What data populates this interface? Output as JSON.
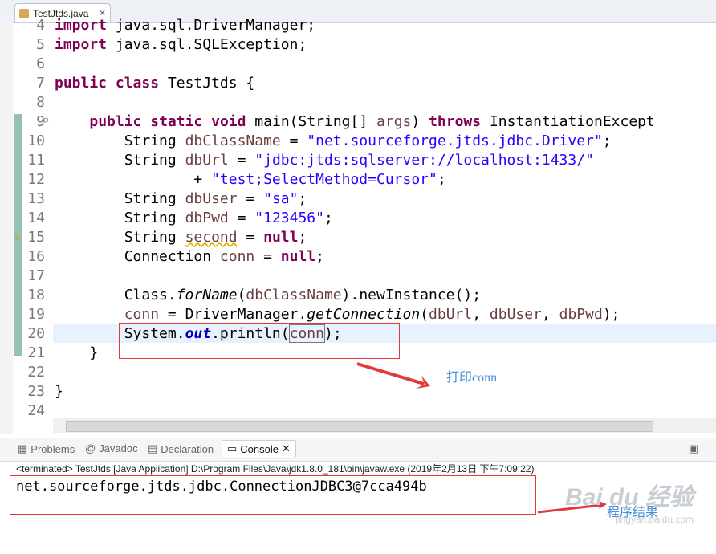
{
  "editor": {
    "tab_label": "TestJtds.java",
    "close_glyph": "✕",
    "lines": [
      {
        "n": "4",
        "html": "<span class='kw'>import</span> java.sql.DriverManager;"
      },
      {
        "n": "5",
        "html": "<span class='kw'>import</span> java.sql.SQLException;"
      },
      {
        "n": "6",
        "html": ""
      },
      {
        "n": "7",
        "html": "<span class='kw'>public</span> <span class='kw'>class</span> TestJtds {"
      },
      {
        "n": "8",
        "html": ""
      },
      {
        "n": "9",
        "html": "    <span class='kw'>public</span> <span class='kw'>static</span> <span class='kw'>void</span> main(String[] <span class='var'>args</span>) <span class='kw'>throws</span> InstantiationExcept"
      },
      {
        "n": "10",
        "html": "        String <span class='var'>dbClassName</span> = <span class='str'>\"net.sourceforge.jtds.jdbc.Driver\"</span>;"
      },
      {
        "n": "11",
        "html": "        String <span class='var'>dbUrl</span> = <span class='str'>\"jdbc:jtds:sqlserver://localhost:1433/\"</span>"
      },
      {
        "n": "12",
        "html": "                + <span class='str'>\"test;SelectMethod=Cursor\"</span>;"
      },
      {
        "n": "13",
        "html": "        String <span class='var'>dbUser</span> = <span class='str'>\"sa\"</span>;"
      },
      {
        "n": "14",
        "html": "        String <span class='var'>dbPwd</span> = <span class='str'>\"123456\"</span>;"
      },
      {
        "n": "15",
        "html": "        String <span class='var' style='text-decoration:underline wavy #e0b000'>second</span> = <span class='kw'>null</span>;"
      },
      {
        "n": "16",
        "html": "        Connection <span class='var'>conn</span> = <span class='kw'>null</span>;"
      },
      {
        "n": "17",
        "html": ""
      },
      {
        "n": "18",
        "html": "        Class.<span class='it'>forName</span>(<span class='var'>dbClassName</span>).newInstance();"
      },
      {
        "n": "19",
        "html": "        <span class='var'>conn</span> = DriverManager.<span class='it'>getConnection</span>(<span class='var'>dbUrl</span>, <span class='var'>dbUser</span>, <span class='var'>dbPwd</span>);"
      },
      {
        "n": "20",
        "html": "        System.<span class='field'>out</span>.println(<span style='outline:1px solid #777'><span class='var'>conn</span></span>);"
      },
      {
        "n": "21",
        "html": "    }"
      },
      {
        "n": "22",
        "html": ""
      },
      {
        "n": "23",
        "html": "}"
      },
      {
        "n": "24",
        "html": ""
      }
    ]
  },
  "annotations": {
    "print_note": "打印conn",
    "result_note": "程序结果"
  },
  "panel": {
    "tabs": [
      "Problems",
      "Javadoc",
      "Declaration",
      "Console"
    ],
    "active_tab": "Console",
    "status_line": "<terminated> TestJtds [Java Application] D:\\Program Files\\Java\\jdk1.8.0_181\\bin\\javaw.exe (2019年2月13日 下午7:09:22)",
    "output": "net.sourceforge.jtds.jdbc.ConnectionJDBC3@7cca494b"
  },
  "watermark": {
    "brand": "Bai du 经验",
    "url": "jingyan.baidu.com"
  },
  "colors": {
    "keyword": "#7f0055",
    "string": "#2a00ff",
    "variable": "#6a3e3e",
    "annotation": "#4a90d9",
    "redbox": "#e23a3a"
  }
}
